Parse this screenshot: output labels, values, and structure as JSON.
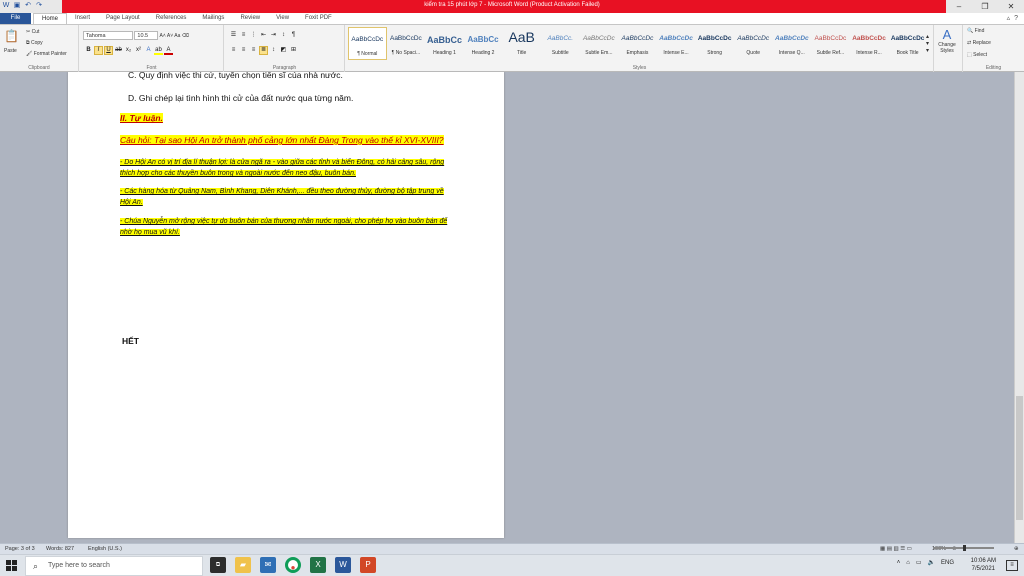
{
  "window": {
    "title": "kiểm tra 15 phút lớp 7 - Microsoft Word (Product Activation Failed)"
  },
  "tabs": [
    {
      "label": "File"
    },
    {
      "label": "Home"
    },
    {
      "label": "Insert"
    },
    {
      "label": "Page Layout"
    },
    {
      "label": "References"
    },
    {
      "label": "Mailings"
    },
    {
      "label": "Review"
    },
    {
      "label": "View"
    },
    {
      "label": "Foxit PDF"
    }
  ],
  "ribbon": {
    "clipboard": {
      "paste": "Paste",
      "cut": "Cut",
      "copy": "Copy",
      "format_painter": "Format Painter",
      "label": "Clipboard"
    },
    "font": {
      "name": "Tahoma",
      "size": "10.5",
      "label": "Font"
    },
    "paragraph": {
      "label": "Paragraph"
    },
    "styles_label": "Styles",
    "styles": [
      {
        "sample": "AaBbCcDc",
        "name": "¶ Normal"
      },
      {
        "sample": "AaBbCcDc",
        "name": "¶ No Spaci..."
      },
      {
        "sample": "AaBbCc",
        "name": "Heading 1"
      },
      {
        "sample": "AaBbCc",
        "name": "Heading 2"
      },
      {
        "sample": "AaB",
        "name": "Title"
      },
      {
        "sample": "AaBbCc.",
        "name": "Subtitle"
      },
      {
        "sample": "AaBbCcDc",
        "name": "Subtle Em..."
      },
      {
        "sample": "AaBbCcDc",
        "name": "Emphasis"
      },
      {
        "sample": "AaBbCcDc",
        "name": "Intense E..."
      },
      {
        "sample": "AaBbCcDc",
        "name": "Strong"
      },
      {
        "sample": "AaBbCcDc",
        "name": "Quote"
      },
      {
        "sample": "AaBbCcDc",
        "name": "Intense Q..."
      },
      {
        "sample": "AaBbCcDc",
        "name": "Subtle Ref..."
      },
      {
        "sample": "AaBbCcDc",
        "name": "Intense R..."
      },
      {
        "sample": "AaBbCcDc",
        "name": "Book Title"
      }
    ],
    "change_styles": "Change Styles",
    "editing": {
      "find": "Find",
      "replace": "Replace",
      "select": "Select",
      "label": "Editing"
    }
  },
  "document": {
    "partial_line": "C. Quy định việc thi cử, tuyển chọn tiến sĩ của nhà nước.",
    "option_d": "D. Ghi chép lại tình hình thi cử của đất nước qua từng năm.",
    "section_heading": "II. Tự luận.",
    "question": "Câu hỏi: Tại sao Hội An trở thành phố cảng lớn nhất Đàng Trong vào thế kỉ XVI-XVIII?",
    "answers": [
      "- Do Hội An có vị trí địa lí thuận lợi: là cửa ngã ra - vào giữa các tỉnh và biển Đông, có hải cảng sâu, rộng thích hợp cho các thuyền buôn trong và ngoài nước đến neo đậu, buôn bán.",
      "- Các hàng hóa từ Quảng Nam, Bình Khang, Diên Khánh,... đều theo đường thủy, đường bộ tập trung về Hội An.",
      "- Chúa Nguyễn mở rộng việc tự do buôn bán của thương nhân nước ngoài, cho phép họ vào buôn bán để nhờ họ mua vũ khí."
    ],
    "end_text": "HẾT"
  },
  "status": {
    "page": "Page: 3 of 3",
    "words": "Words: 827",
    "language": "English (U.S.)",
    "zoom": "100%",
    "zoom_fraction": 0.5
  },
  "taskbar": {
    "search_placeholder": "Type here to search",
    "language": "ENG",
    "time": "10:06 AM",
    "date": "7/5/2021"
  }
}
